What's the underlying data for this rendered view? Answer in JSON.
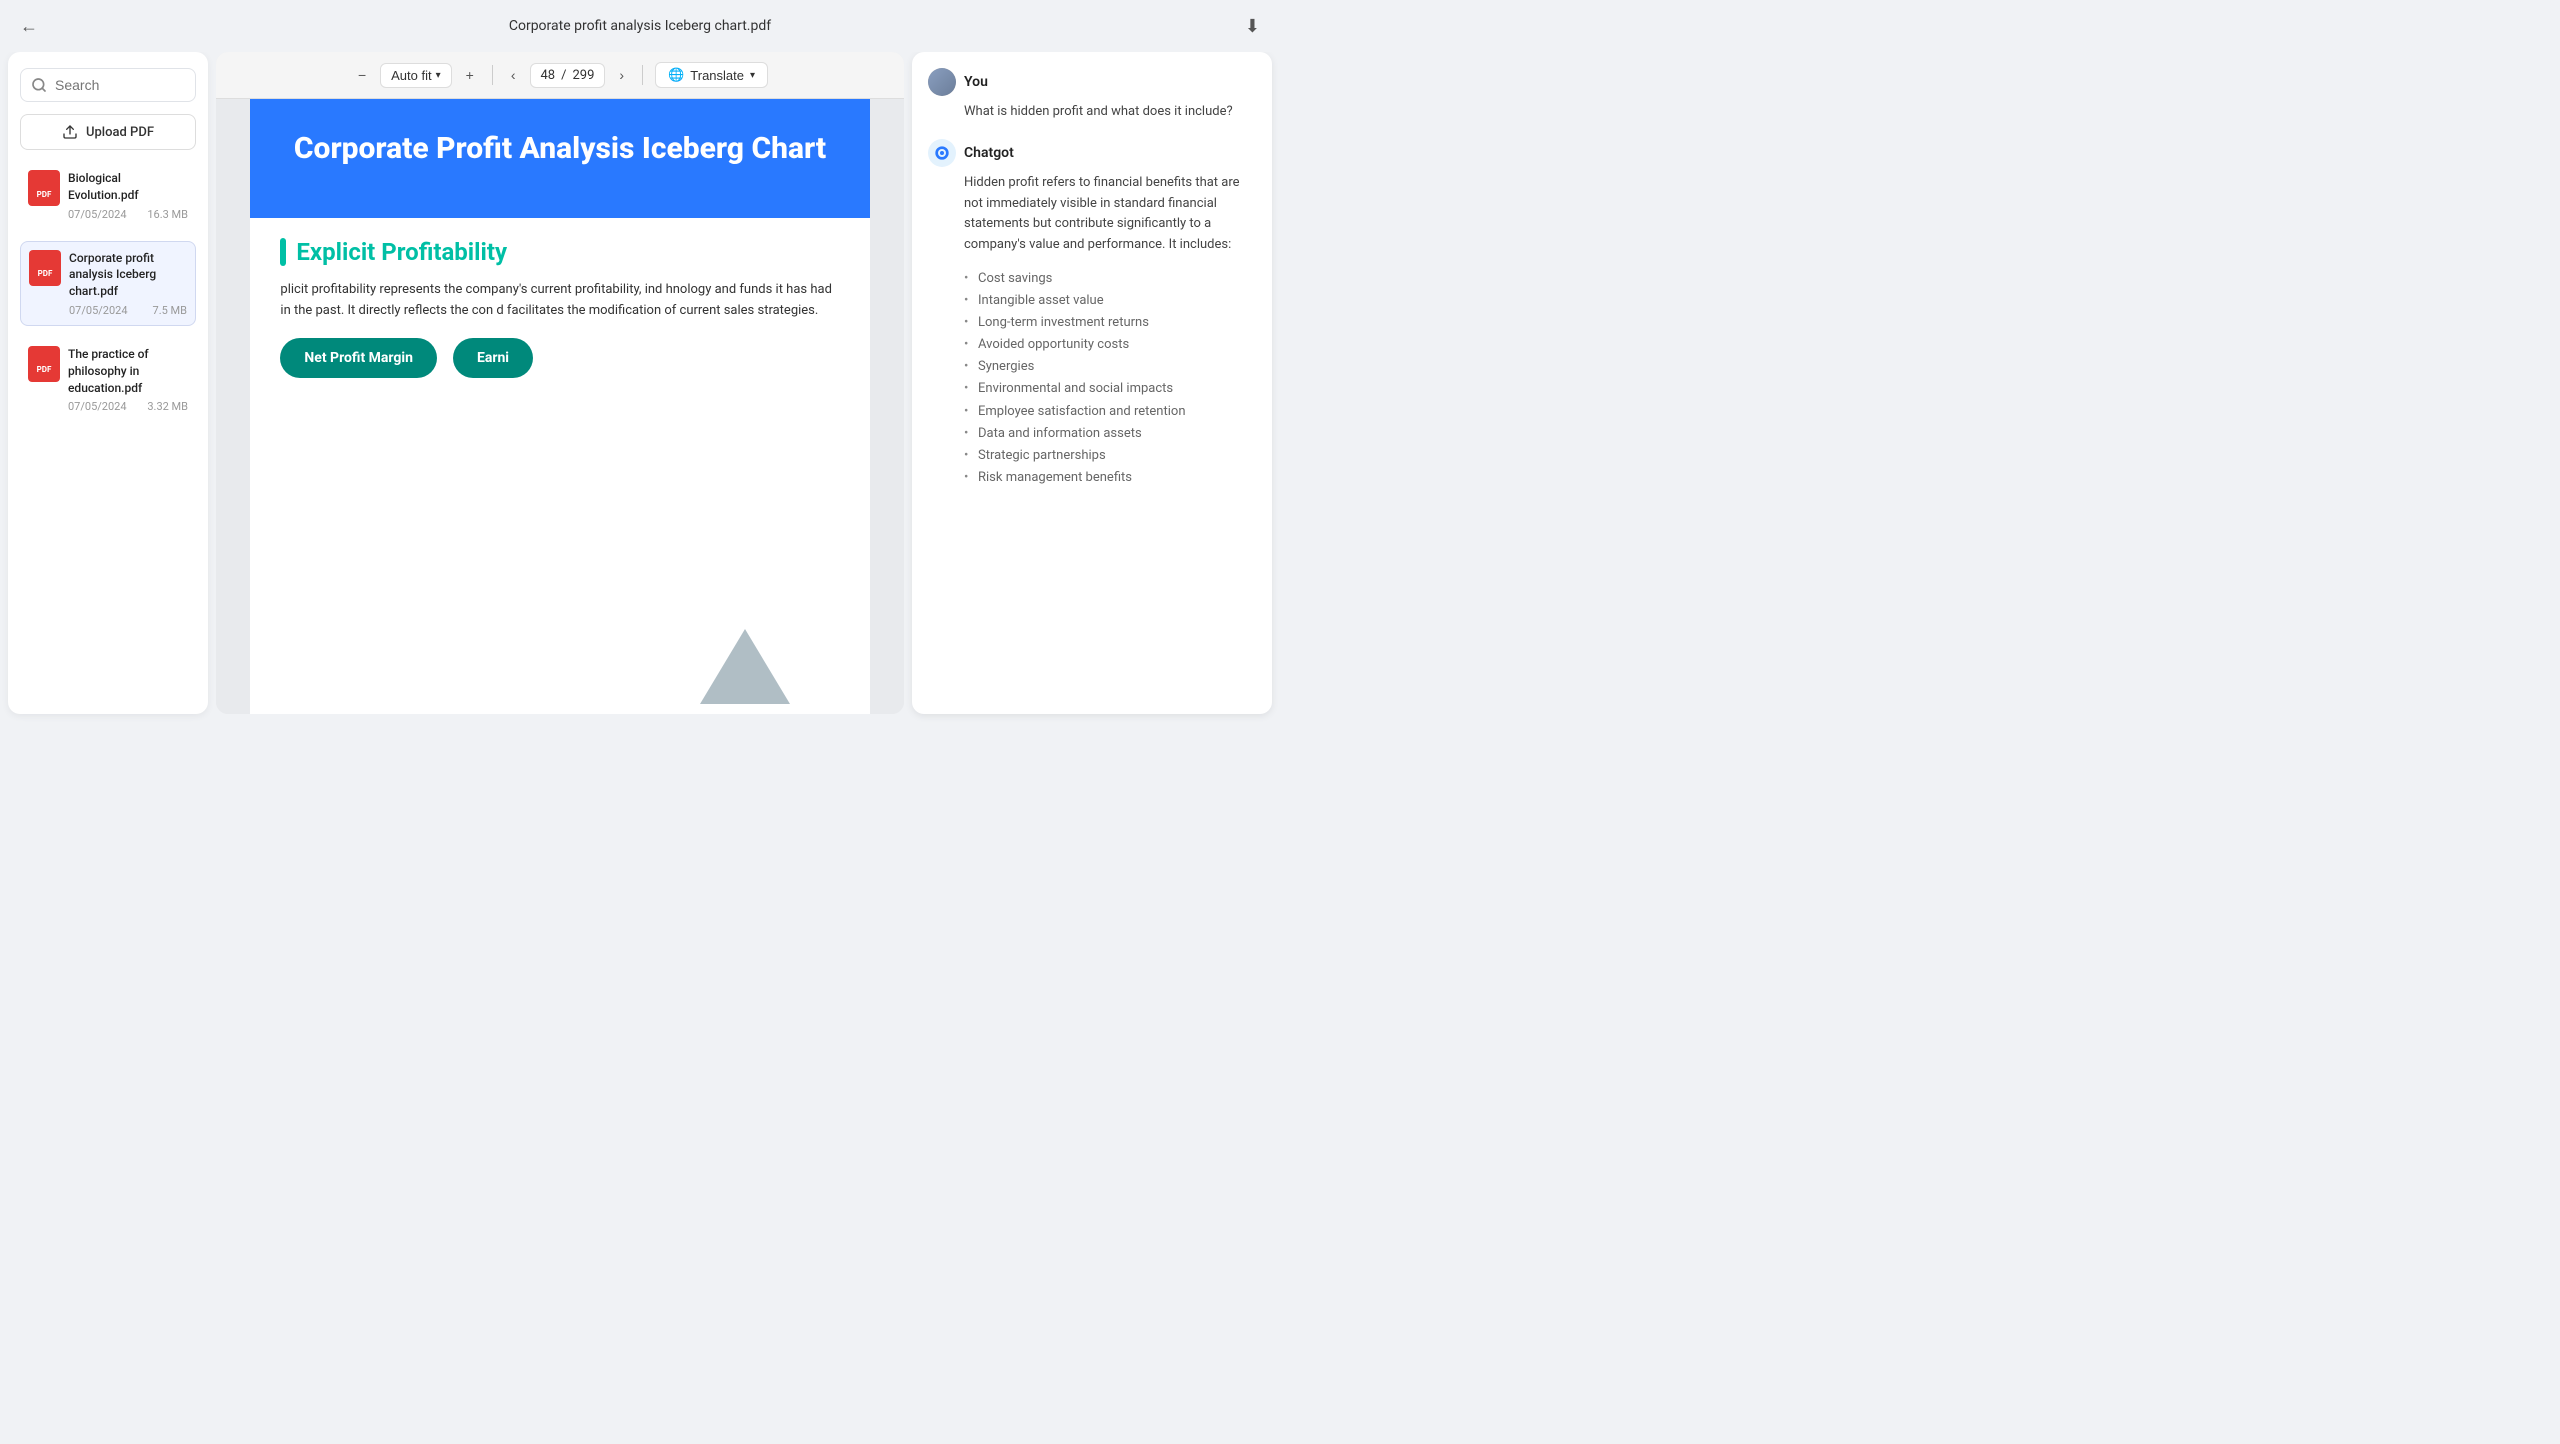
{
  "topbar": {
    "title": "Corporate profit analysis Iceberg chart.pdf",
    "back_icon": "←",
    "download_icon": "⬇"
  },
  "toolbar": {
    "zoom_out": "−",
    "auto_fit": "Auto fit",
    "auto_fit_arrow": "▾",
    "zoom_in": "+",
    "page_prev": "‹",
    "page_current": "48",
    "page_separator": "/",
    "page_total": "299",
    "page_next": "›",
    "translate_icon": "🌐",
    "translate_label": "Translate",
    "translate_arrow": "▾"
  },
  "sidebar": {
    "search_placeholder": "Search",
    "upload_label": "Upload PDF",
    "files": [
      {
        "name": "Biological Evolution.pdf",
        "date": "07/05/2024",
        "size": "16.3 MB",
        "active": false
      },
      {
        "name": "Corporate profit analysis Iceberg chart.pdf",
        "date": "07/05/2024",
        "size": "7.5 MB",
        "active": true
      },
      {
        "name": "The practice of philosophy in education.pdf",
        "date": "07/05/2024",
        "size": "3.32 MB",
        "active": false
      }
    ]
  },
  "pdf": {
    "main_title": "Corporate Profit Analysis Iceberg Chart",
    "section_title": "Explicit Profitability",
    "section_text": "plicit profitability represents the company's current profitability, ind hnology and funds it has had in the past. It directly reflects the con d facilitates the modification of current sales strategies.",
    "pill1": "Net Profit Margin",
    "pill2": "Earni"
  },
  "chat": {
    "user_name": "You",
    "user_question": "What is hidden profit and what does it include?",
    "bot_name": "Chatgot",
    "bot_intro": "Hidden profit refers to financial benefits that are not immediately visible in standard financial statements but contribute significantly to a company's value and performance. It includes:",
    "bot_bullets": [
      "Cost savings",
      "Intangible asset value",
      "Long-term investment returns",
      "Avoided opportunity costs",
      "Synergies",
      "Environmental and social impacts",
      "Employee satisfaction and retention",
      "Data and information assets",
      "Strategic partnerships",
      "Risk management benefits"
    ]
  }
}
